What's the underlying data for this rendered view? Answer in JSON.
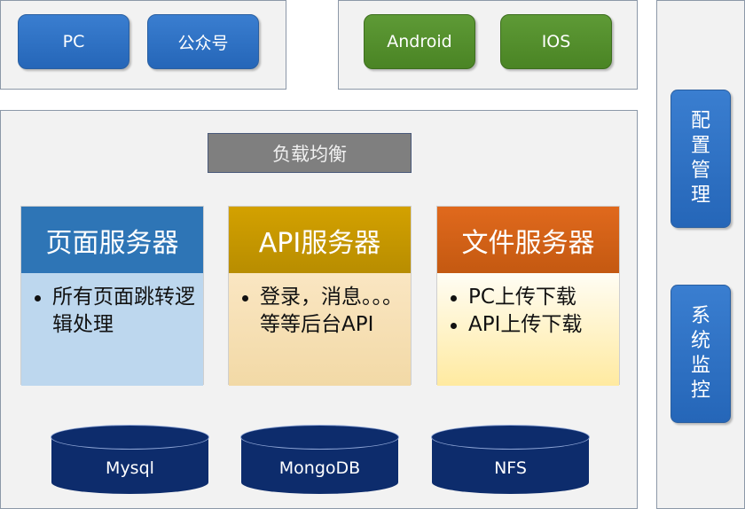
{
  "clients": {
    "pc": "PC",
    "wechat": "公众号",
    "android": "Android",
    "ios": "IOS"
  },
  "load_balancer": "负载均衡",
  "servers": [
    {
      "title": "页面服务器",
      "items": [
        "所有页面跳转逻辑处理"
      ]
    },
    {
      "title": "API服务器",
      "items": [
        "登录，消息。。。等等后台API"
      ]
    },
    {
      "title": "文件服务器",
      "items": [
        "PC上传下载",
        "API上传下载"
      ]
    }
  ],
  "databases": {
    "mysql": "Mysql",
    "mongodb": "MongoDB",
    "nfs": "NFS"
  },
  "side": {
    "config": "配置管理",
    "monitor": "系统监控"
  },
  "colors": {
    "client_blue": "#2e75b6",
    "client_green": "#548235",
    "page_server": "#2e75b6",
    "api_server": "#bf9000",
    "file_server": "#c55a11",
    "database": "#0d2c6c",
    "load_balancer": "#7f7f7f"
  }
}
